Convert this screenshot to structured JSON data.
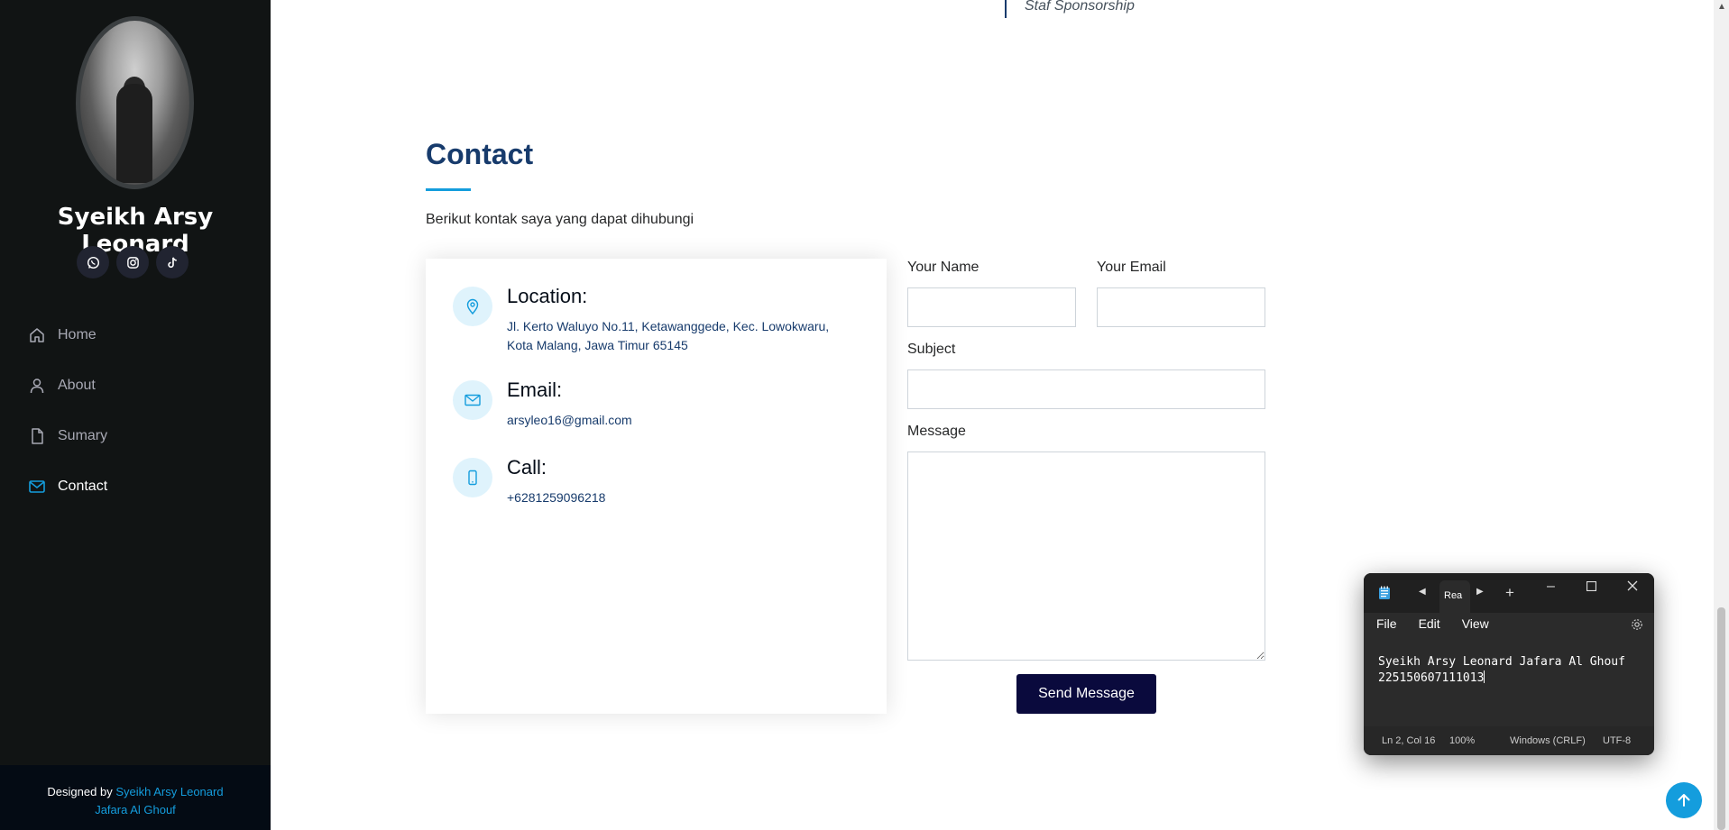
{
  "sidebar": {
    "name": "Syeikh Arsy Leonard",
    "socials": [
      {
        "icon": "whatsapp-icon"
      },
      {
        "icon": "instagram-icon"
      },
      {
        "icon": "tiktok-icon"
      }
    ],
    "nav": [
      {
        "label": "Home",
        "icon": "home-icon"
      },
      {
        "label": "About",
        "icon": "person-icon"
      },
      {
        "label": "Sumary",
        "icon": "file-icon"
      },
      {
        "label": "Contact",
        "icon": "envelope-icon",
        "active": true
      }
    ],
    "footer_prefix": "Designed by",
    "footer_link_line1": "Syeikh Arsy Leonard",
    "footer_link_line2": "Jafara Al Ghouf"
  },
  "resume_snippet": "Staf Sponsorship",
  "contact": {
    "title": "Contact",
    "description": "Berikut kontak saya yang dapat dihubungi",
    "location_title": "Location:",
    "location_line1": "Jl. Kerto Waluyo No.11, Ketawanggede, Kec. Lowokwaru,",
    "location_line2": "Kota Malang, Jawa Timur 65145",
    "email_title": "Email:",
    "email_value": "arsyleo16@gmail.com",
    "call_title": "Call:",
    "call_value": "+6281259096218"
  },
  "form": {
    "name_label": "Your Name",
    "email_label": "Your Email",
    "subject_label": "Subject",
    "message_label": "Message",
    "submit_label": "Send Message"
  },
  "notepad": {
    "tab_label": "Rea",
    "menu": [
      "File",
      "Edit",
      "View"
    ],
    "line1": "Syeikh Arsy Leonard Jafara Al Ghouf",
    "line2": "225150607111013",
    "status_pos": "Ln 2, Col 16",
    "status_zoom": "100%",
    "status_eol": "Windows (CRLF)",
    "status_enc": "UTF-8"
  },
  "colors": {
    "accent": "#149ddd",
    "heading": "#173b6c",
    "sidebar_bg": "#111414",
    "button": "#0a0a3d"
  }
}
